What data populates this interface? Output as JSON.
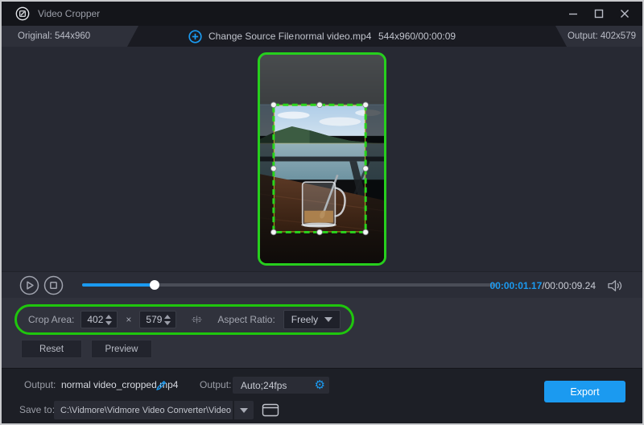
{
  "window": {
    "title": "Video Cropper"
  },
  "info_bar": {
    "original_label": "Original: 544x960",
    "change_source_label": "Change Source File",
    "file_name": "normal video.mp4",
    "file_meta": "544x960/00:00:09",
    "output_label": "Output: 402x579"
  },
  "player": {
    "current_time": "00:00:01.17",
    "separator": "/",
    "duration": "00:00:09.24",
    "progress_percent": 17.5
  },
  "crop_controls": {
    "crop_area_label": "Crop Area:",
    "width_value": "402",
    "multiply_sign": "×",
    "height_value": "579",
    "aspect_ratio_label": "Aspect Ratio:",
    "aspect_ratio_value": "Freely"
  },
  "buttons": {
    "reset": "Reset",
    "preview": "Preview",
    "export": "Export"
  },
  "output_bar": {
    "output_label": "Output:",
    "output_filename": "normal video_cropped.mp4",
    "format_label": "Output:",
    "format_value": "Auto;24fps",
    "save_to_label": "Save to:",
    "save_path": "C:\\Vidmore\\Vidmore Video Converter\\Video Crop"
  },
  "icons": {
    "gear": "⚙",
    "app": "crop-frame-in-circle",
    "add": "plus-in-circle",
    "volume": "speaker-with-waves",
    "crop_center": "crosshair-with-corner-brackets"
  },
  "colors": {
    "accent_blue": "#1b9af0",
    "highlight_green": "#1fc60d",
    "crop_border_green": "#26cf1d",
    "time_blue": "#1b9af0",
    "export_bg": "#1b9af0"
  }
}
